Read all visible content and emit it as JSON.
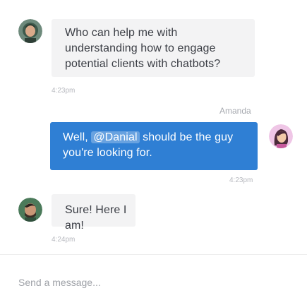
{
  "messages": [
    {
      "direction": "incoming",
      "avatar": "person-avatar-green",
      "text": "Who can help me with understanding how to engage potential clients with chatbots?",
      "time": "4:23pm"
    },
    {
      "direction": "outgoing",
      "sender": "Amanda",
      "avatar": "person-avatar-amanda",
      "text_before": "Well, ",
      "mention": "@Danial",
      "text_after": " should be the guy you're looking for.",
      "time": "4:23pm"
    },
    {
      "direction": "incoming",
      "avatar": "person-avatar-danial",
      "text": "Sure! Here I am!",
      "time": "4:24pm"
    }
  ],
  "composer": {
    "placeholder": "Send a message..."
  },
  "colors": {
    "outgoing_bubble": "#2f7fd4",
    "incoming_bubble": "#f3f3f4",
    "timestamp": "#b6b8be"
  }
}
